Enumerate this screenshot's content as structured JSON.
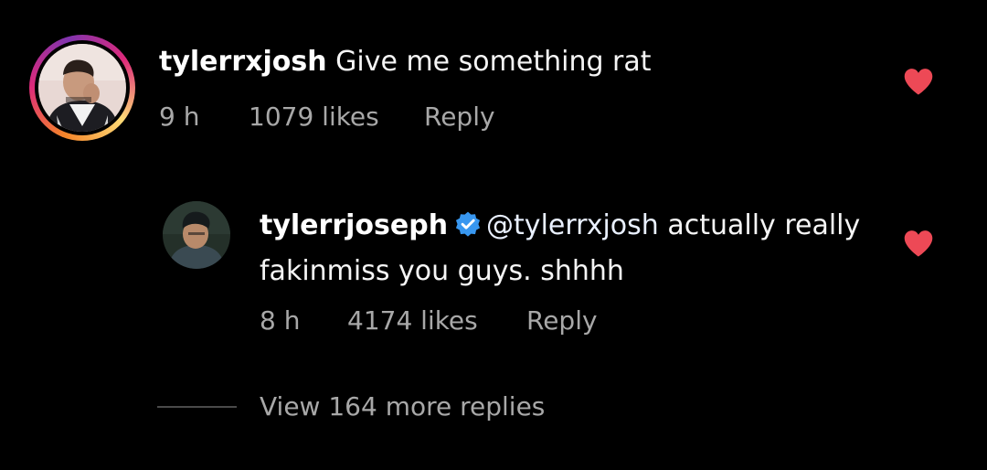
{
  "comment": {
    "username": "tylerrxjosh",
    "text": "Give me something rat",
    "time": "9 h",
    "likes": "1079 likes",
    "reply_label": "Reply",
    "liked": true
  },
  "reply": {
    "username": "tylerrjoseph",
    "verified": true,
    "mention": "@tylerrxjosh",
    "text": " actually really fakinmiss you guys. shhhh",
    "time": "8 h",
    "likes": "4174 likes",
    "reply_label": "Reply",
    "liked": true
  },
  "view_more": {
    "label": "View 164 more replies"
  },
  "colors": {
    "background": "#000000",
    "heart": "#ed4956",
    "verified": "#3897f0",
    "muted_text": "#a8a8a8"
  },
  "icons": {
    "like": "heart-icon",
    "verified": "verified-badge-icon"
  }
}
